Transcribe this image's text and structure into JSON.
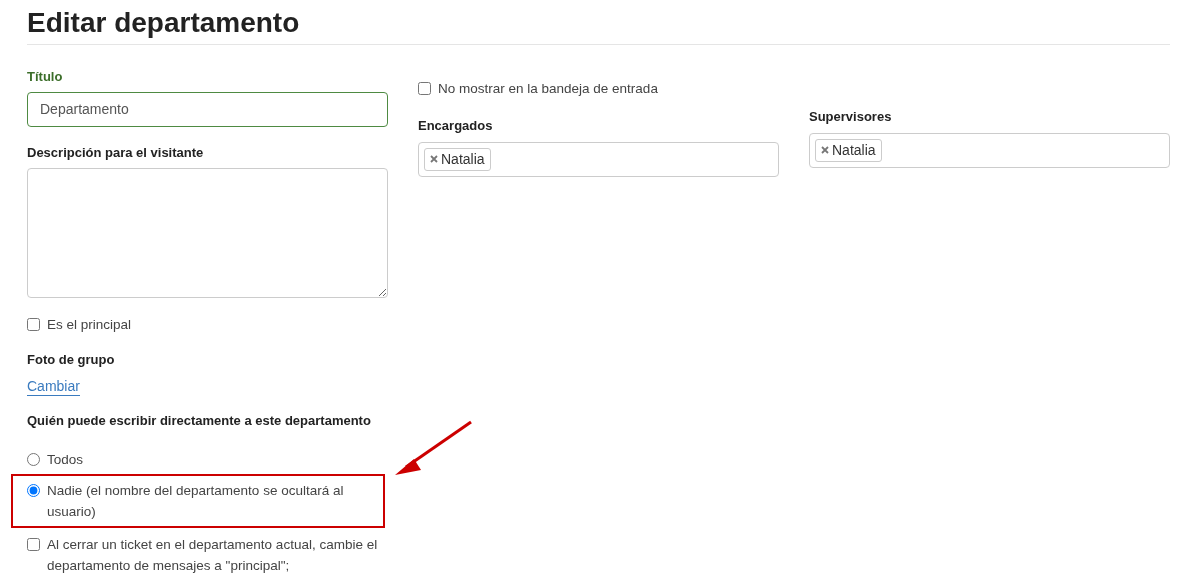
{
  "page_title": "Editar departamento",
  "title_field": {
    "label": "Título",
    "value": "Departamento"
  },
  "description_field": {
    "label": "Descripción para el visitante"
  },
  "main_checkbox": {
    "label": "Es el principal",
    "checked": false
  },
  "group_photo": {
    "label": "Foto de grupo",
    "link": "Cambiar"
  },
  "who_can_write": {
    "label": "Quién puede escribir directamente a este departamento",
    "options": [
      {
        "label": "Todos",
        "selected": false,
        "highlighted": false
      },
      {
        "label": "Nadie (el nombre del departamento se ocultará al usuario)",
        "selected": true,
        "highlighted": true
      }
    ]
  },
  "close_ticket_checkbox": {
    "label": "Al cerrar un ticket en el departamento actual, cambie el departamento de mensajes a \"principal\";",
    "checked": false
  },
  "hide_inbox_checkbox": {
    "label": "No mostrar en la bandeja de entrada",
    "checked": false
  },
  "managers": {
    "label": "Encargados",
    "tags": [
      "Natalia"
    ]
  },
  "supervisors": {
    "label": "Supervisores",
    "tags": [
      "Natalia"
    ]
  }
}
